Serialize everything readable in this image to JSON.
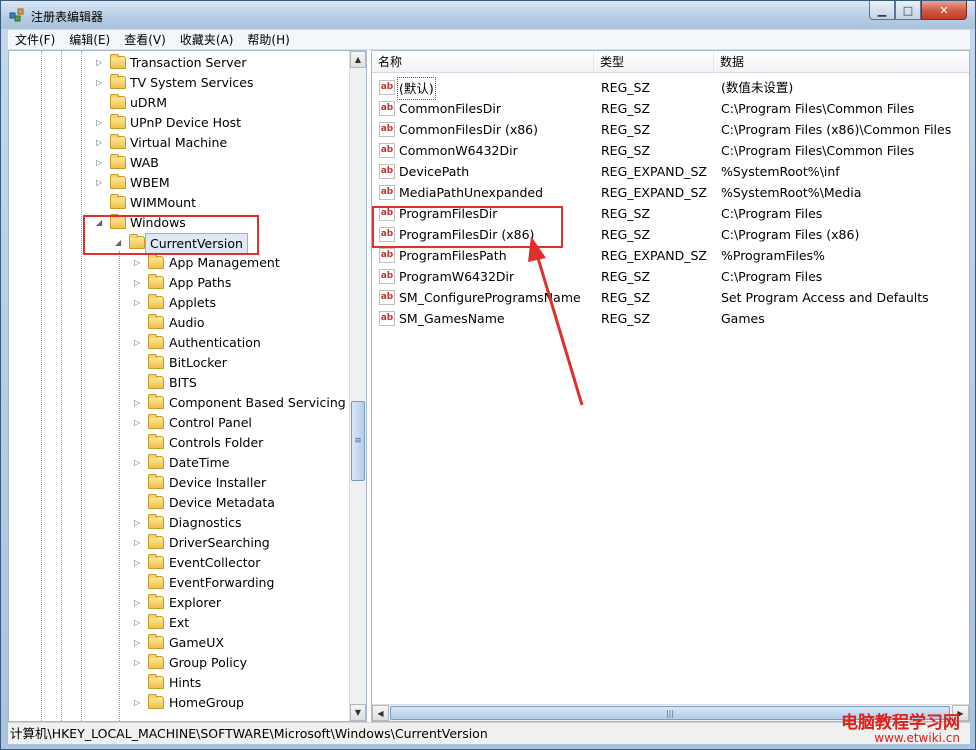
{
  "window": {
    "title": "注册表编辑器",
    "buttons": {
      "minimize": "▁",
      "maximize": "□",
      "close": "✕"
    }
  },
  "menu": [
    "文件(F)",
    "编辑(E)",
    "查看(V)",
    "收藏夹(A)",
    "帮助(H)"
  ],
  "tree": {
    "top_items": [
      "Transaction Server",
      "TV System Services",
      "uDRM",
      "UPnP Device Host",
      "Virtual Machine",
      "WAB",
      "WBEM",
      "WIMMount",
      "Windows"
    ],
    "selected": "CurrentVersion",
    "children": [
      "App Management",
      "App Paths",
      "Applets",
      "Audio",
      "Authentication",
      "BitLocker",
      "BITS",
      "Component Based Servicing",
      "Control Panel",
      "Controls Folder",
      "DateTime",
      "Device Installer",
      "Device Metadata",
      "Diagnostics",
      "DriverSearching",
      "EventCollector",
      "EventForwarding",
      "Explorer",
      "Ext",
      "GameUX",
      "Group Policy",
      "Hints",
      "HomeGroup"
    ]
  },
  "list": {
    "headers": {
      "name": "名称",
      "type": "类型",
      "data": "数据"
    },
    "icon_text": "ab",
    "rows": [
      {
        "name": "(默认)",
        "type": "REG_SZ",
        "data": "(数值未设置)"
      },
      {
        "name": "CommonFilesDir",
        "type": "REG_SZ",
        "data": "C:\\Program Files\\Common Files"
      },
      {
        "name": "CommonFilesDir (x86)",
        "type": "REG_SZ",
        "data": "C:\\Program Files (x86)\\Common Files"
      },
      {
        "name": "CommonW6432Dir",
        "type": "REG_SZ",
        "data": "C:\\Program Files\\Common Files"
      },
      {
        "name": "DevicePath",
        "type": "REG_EXPAND_SZ",
        "data": "%SystemRoot%\\inf"
      },
      {
        "name": "MediaPathUnexpanded",
        "type": "REG_EXPAND_SZ",
        "data": "%SystemRoot%\\Media"
      },
      {
        "name": "ProgramFilesDir",
        "type": "REG_SZ",
        "data": "C:\\Program Files"
      },
      {
        "name": "ProgramFilesDir (x86)",
        "type": "REG_SZ",
        "data": "C:\\Program Files (x86)"
      },
      {
        "name": "ProgramFilesPath",
        "type": "REG_EXPAND_SZ",
        "data": "%ProgramFiles%"
      },
      {
        "name": "ProgramW6432Dir",
        "type": "REG_SZ",
        "data": "C:\\Program Files"
      },
      {
        "name": "SM_ConfigureProgramsName",
        "type": "REG_SZ",
        "data": "Set Program Access and Defaults"
      },
      {
        "name": "SM_GamesName",
        "type": "REG_SZ",
        "data": "Games"
      }
    ]
  },
  "status": "计算机\\HKEY_LOCAL_MACHINE\\SOFTWARE\\Microsoft\\Windows\\CurrentVersion",
  "watermark": {
    "main": "电脑教程学习网",
    "url": "www.etwiki.cn"
  },
  "colors": {
    "highlight": "#e0302d",
    "selection": "#dfe8f4"
  }
}
